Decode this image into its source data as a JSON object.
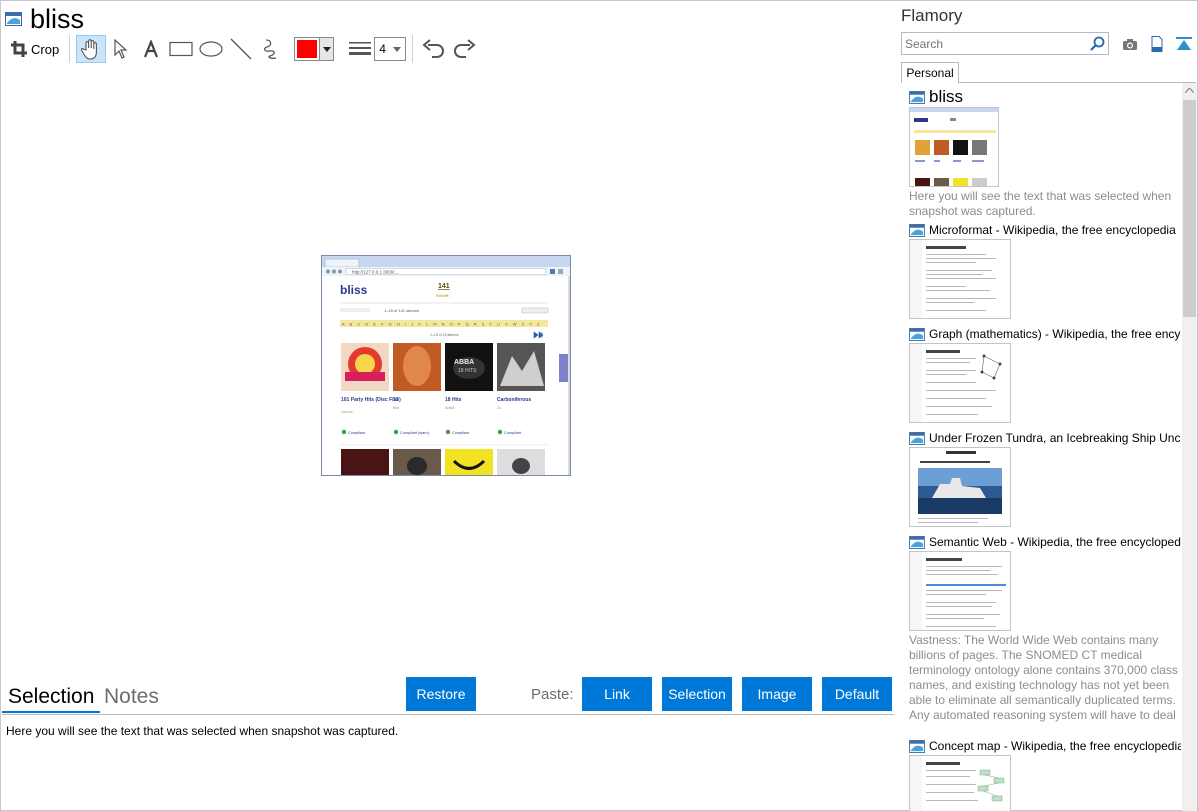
{
  "document": {
    "title": "bliss"
  },
  "toolbar": {
    "crop_label": "Crop",
    "color": "#ff0000",
    "width_value": "4"
  },
  "snapshot": {
    "logo": "bliss",
    "url": "http://127.0.0.1:3000/...",
    "count": "141",
    "count_sub": "Fold left",
    "filter_text": "1–15 of 141 albums",
    "albums": [
      {
        "title": "101 Party Hits (Disc Five)",
        "artist": "Various",
        "status": "Compliant"
      },
      {
        "title": "13",
        "artist": "Blur",
        "status": "Compliant (warn)"
      },
      {
        "title": "18 Hits",
        "artist": "ABBA",
        "status": "Compliant"
      },
      {
        "title": "Carboniferous",
        "artist": "Zu",
        "status": "Compliant"
      }
    ]
  },
  "bottom": {
    "tabs": {
      "selection": "Selection",
      "notes": "Notes"
    },
    "restore": "Restore",
    "paste_label": "Paste:",
    "paste_buttons": {
      "link": "Link",
      "selection": "Selection",
      "image": "Image",
      "default": "Default"
    },
    "selection_text": "Here you will see the text that was selected when snapshot was captured."
  },
  "sidebar": {
    "app_title": "Flamory",
    "search_placeholder": "Search",
    "tab": "Personal",
    "items": [
      {
        "title": "bliss",
        "excerpt": "Here you will see the text that was selected when snapshot was captured."
      },
      {
        "title": "Microformat - Wikipedia, the free encyclopedia",
        "excerpt": ""
      },
      {
        "title": "Graph (mathematics) - Wikipedia, the free encyclopedia",
        "excerpt": ""
      },
      {
        "title": "Under Frozen Tundra, an Icebreaking Ship Uncovers...",
        "excerpt": ""
      },
      {
        "title": "Semantic Web - Wikipedia, the free encyclopedia",
        "excerpt": "Vastness: The World Wide Web contains many billions of pages. The SNOMED CT medical terminology ontology alone contains 370,000 class names, and existing technology has not yet been able to eliminate all semantically duplicated terms. Any automated reasoning system will have to deal with truly huge inputs."
      },
      {
        "title": "Concept map - Wikipedia, the free encyclopedia",
        "excerpt": ""
      }
    ]
  }
}
